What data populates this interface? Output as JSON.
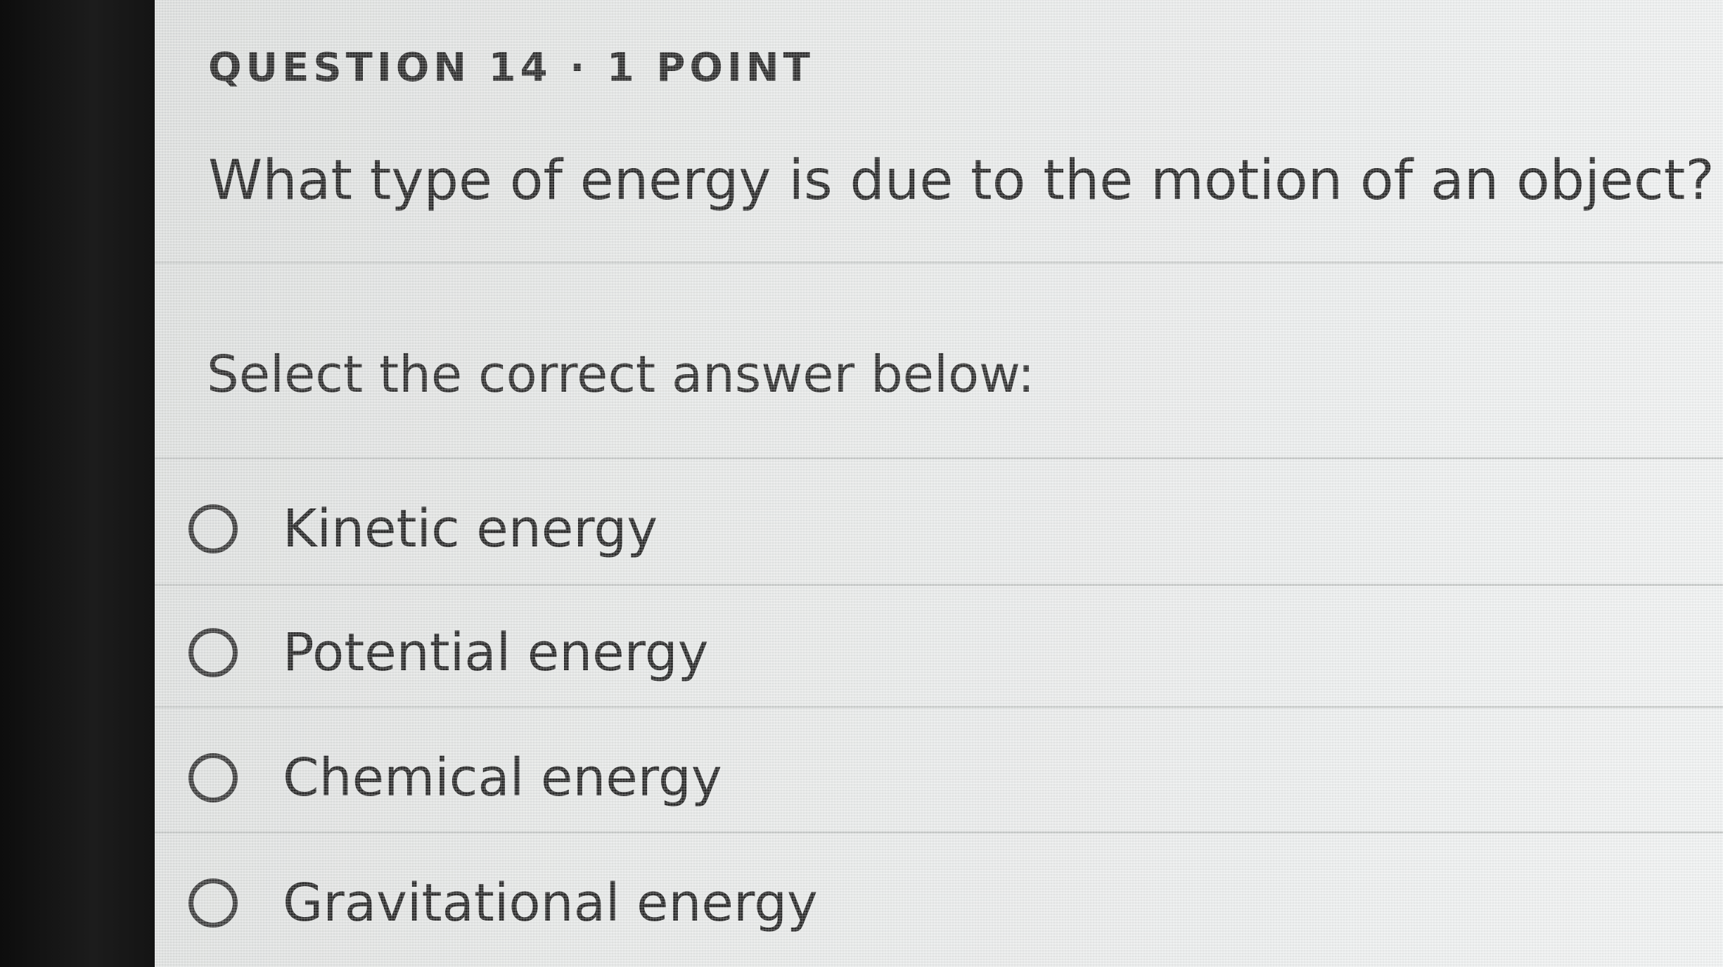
{
  "question": {
    "header": "QUESTION 14 · 1 POINT",
    "text": "What type of energy is due to the motion of an object?",
    "instruction": "Select the correct answer below:"
  },
  "options": [
    {
      "label": "Kinetic energy",
      "selected": false
    },
    {
      "label": "Potential energy",
      "selected": false
    },
    {
      "label": "Chemical energy",
      "selected": false
    },
    {
      "label": "Gravitational energy",
      "selected": false
    }
  ]
}
